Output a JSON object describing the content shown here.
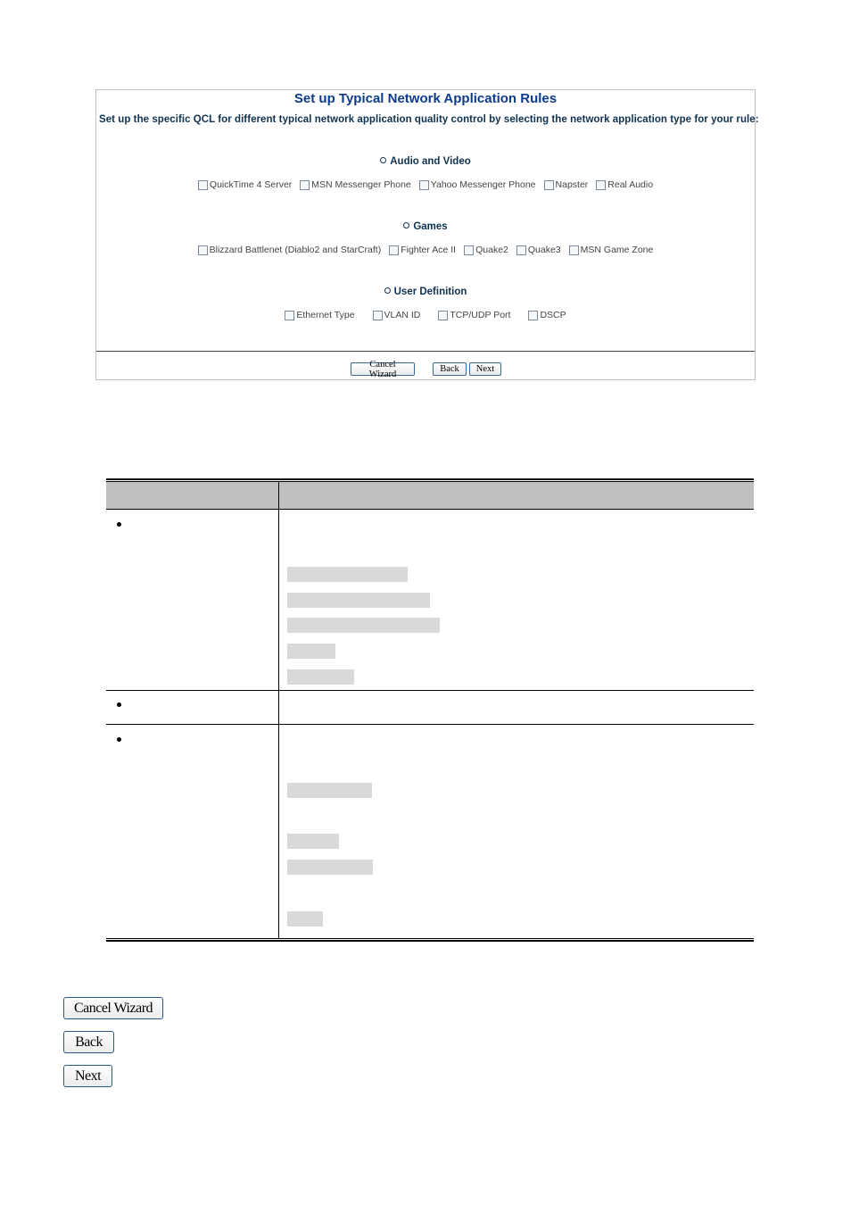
{
  "panel": {
    "title": "Set up Typical Network Application Rules",
    "description": "Set up the specific QCL for different typical network application quality control by selecting the network application type for your rule:",
    "sections": [
      {
        "heading": "Audio and Video",
        "options": [
          {
            "label": "QuickTime 4 Server",
            "checked": false
          },
          {
            "label": "MSN Messenger Phone",
            "checked": false
          },
          {
            "label": "Yahoo Messenger Phone",
            "checked": false
          },
          {
            "label": "Napster",
            "checked": false
          },
          {
            "label": "Real Audio",
            "checked": false
          }
        ]
      },
      {
        "heading": "Games",
        "options": [
          {
            "label": "Blizzard Battlenet (Diablo2 and StarCraft)",
            "checked": false
          },
          {
            "label": "Fighter Ace II",
            "checked": false
          },
          {
            "label": "Quake2",
            "checked": false
          },
          {
            "label": "Quake3",
            "checked": false
          },
          {
            "label": "MSN Game Zone",
            "checked": false
          }
        ]
      },
      {
        "heading": "User Definition",
        "options": [
          {
            "label": "Ethernet Type",
            "checked": false
          },
          {
            "label": "VLAN ID",
            "checked": false
          },
          {
            "label": "TCP/UDP Port",
            "checked": false
          },
          {
            "label": "DSCP",
            "checked": false
          }
        ]
      }
    ],
    "buttons": {
      "cancel": "Cancel Wizard",
      "back": "Back",
      "next": "Next"
    }
  },
  "bottom_buttons": {
    "cancel": "Cancel Wizard",
    "back": "Back",
    "next": "Next"
  }
}
